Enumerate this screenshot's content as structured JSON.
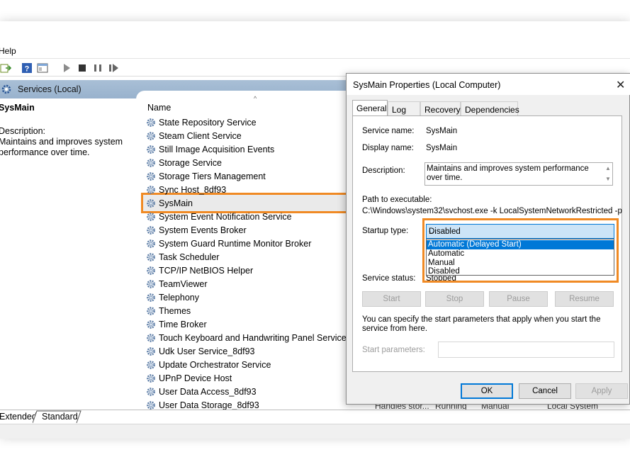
{
  "menubar": {
    "help": "Help"
  },
  "left": {
    "header": "Services (Local)",
    "selected_name": "SysMain",
    "description_label": "Description:",
    "description_text": "Maintains and improves system performance over time.",
    "column_name": "Name",
    "services": [
      "State Repository Service",
      "Steam Client Service",
      "Still Image Acquisition Events",
      "Storage Service",
      "Storage Tiers Management",
      "Sync Host_8df93",
      "SysMain",
      "System Event Notification Service",
      "System Events Broker",
      "System Guard Runtime Monitor Broker",
      "Task Scheduler",
      "TCP/IP NetBIOS Helper",
      "TeamViewer",
      "Telephony",
      "Themes",
      "Time Broker",
      "Touch Keyboard and Handwriting Panel Service",
      "Udk User Service_8df93",
      "Update Orchestrator Service",
      "UPnP Device Host",
      "User Data Access_8df93",
      "User Data Storage_8df93"
    ],
    "partial_row": {
      "description": "Handles stor...",
      "status": "Running",
      "startup": "Manual",
      "logon": "Local System"
    }
  },
  "bottom_tabs": {
    "extended": "Extended",
    "standard": "Standard"
  },
  "dialog": {
    "title": "SysMain Properties (Local Computer)",
    "close_icon": "close-icon",
    "tabs": [
      "General",
      "Log On",
      "Recovery",
      "Dependencies"
    ],
    "service_name_label": "Service name:",
    "service_name_value": "SysMain",
    "display_name_label": "Display name:",
    "display_name_value": "SysMain",
    "description_label": "Description:",
    "description_value": "Maintains and improves system performance over time.",
    "path_label": "Path to executable:",
    "path_value": "C:\\Windows\\system32\\svchost.exe -k LocalSystemNetworkRestricted -p",
    "startup_type_label": "Startup type:",
    "startup_type_selected": "Disabled",
    "startup_options": [
      "Automatic (Delayed Start)",
      "Automatic",
      "Manual",
      "Disabled"
    ],
    "startup_highlighted": "Automatic (Delayed Start)",
    "service_status_label": "Service status:",
    "service_status_value": "Stopped",
    "control_buttons": [
      "Start",
      "Stop",
      "Pause",
      "Resume"
    ],
    "hint": "You can specify the start parameters that apply when you start the service from here.",
    "start_params_label": "Start parameters:",
    "ok": "OK",
    "cancel": "Cancel",
    "apply": "Apply"
  },
  "colors": {
    "highlight_outline": "#f08a24",
    "selection_blue": "#0078d7",
    "header_blue": "#a9bfd6"
  }
}
